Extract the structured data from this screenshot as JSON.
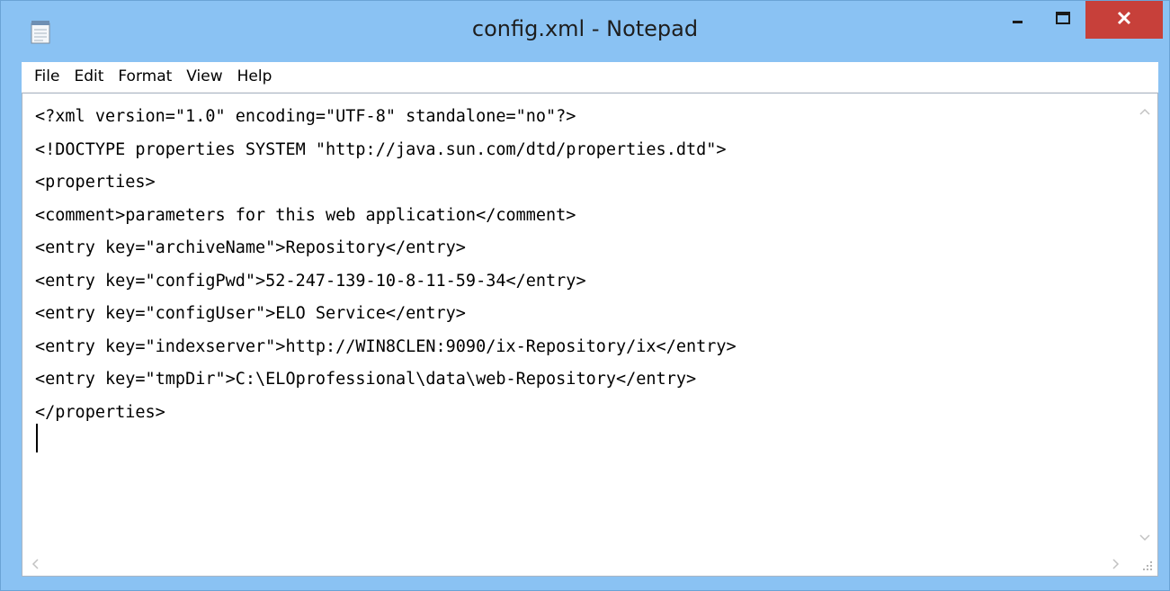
{
  "window": {
    "title": "config.xml - Notepad"
  },
  "titlebar": {
    "app_icon": "notepad-icon",
    "minimize_icon": "minimize-icon",
    "maximize_icon": "maximize-icon",
    "close_icon": "close-icon",
    "close_color": "#c7403a",
    "frame_color": "#8ac2f3"
  },
  "menu": {
    "items": [
      "File",
      "Edit",
      "Format",
      "View",
      "Help"
    ]
  },
  "editor": {
    "lines": [
      "<?xml version=\"1.0\" encoding=\"UTF-8\" standalone=\"no\"?>",
      "<!DOCTYPE properties SYSTEM \"http://java.sun.com/dtd/properties.dtd\">",
      "<properties>",
      "<comment>parameters for this web application</comment>",
      "<entry key=\"archiveName\">Repository</entry>",
      "<entry key=\"configPwd\">52-247-139-10-8-11-59-34</entry>",
      "<entry key=\"configUser\">ELO Service</entry>",
      "<entry key=\"indexserver\">http://WIN8CLEN:9090/ix-Repository/ix</entry>",
      "<entry key=\"tmpDir\">C:\\ELOprofessional\\data\\web-Repository</entry>",
      "</properties>"
    ]
  },
  "scrollbars": {
    "up_icon": "chevron-up-icon",
    "down_icon": "chevron-down-icon",
    "left_icon": "chevron-left-icon",
    "right_icon": "chevron-right-icon",
    "grip_icon": "resize-grip-icon"
  }
}
